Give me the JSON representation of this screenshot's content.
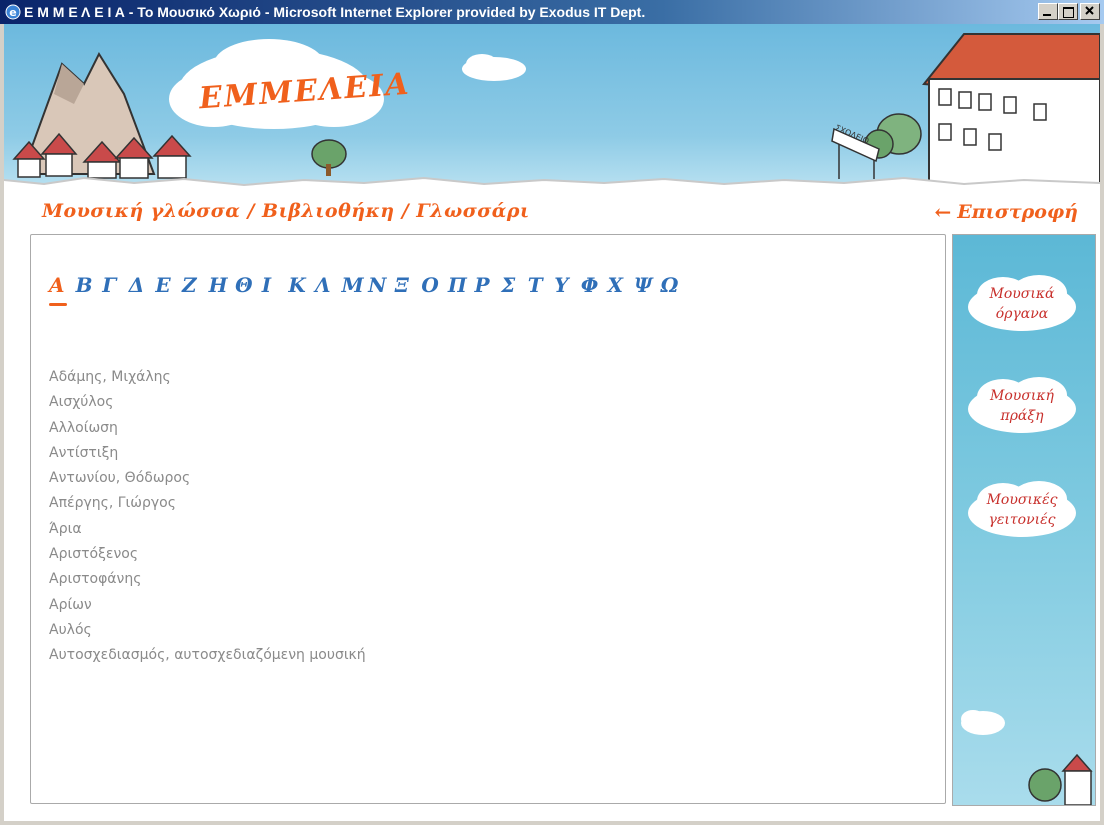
{
  "window": {
    "title": "Ε Μ Μ Ε Λ Ε Ι Α - Το Μουσικό Χωριό - Microsoft Internet Explorer provided by Exodus IT Dept."
  },
  "header": {
    "logo_text": "EMMEΛEIA",
    "school_sign": "ΣΧΟΛΕΙΟ"
  },
  "breadcrumb": "Μουσική γλώσσα / Βιβλιοθήκη / Γλωσσάρι",
  "back_link": "Επιστροφή",
  "alphabet": [
    "Α",
    "Β",
    "Γ",
    "Δ",
    "Ε",
    "Ζ",
    "Η",
    "Θ",
    "Ι",
    "Κ",
    "Λ",
    "Μ",
    "Ν",
    "Ξ",
    "Ο",
    "Π",
    "Ρ",
    "Σ",
    "Τ",
    "Υ",
    "Φ",
    "Χ",
    "Ψ",
    "Ω"
  ],
  "active_letter": "Α",
  "terms": [
    "Αδάμης, Μιχάλης",
    "Αισχύλος",
    "Αλλοίωση",
    "Αντίστιξη",
    "Αντωνίου, Θόδωρος",
    "Απέργης, Γιώργος",
    "Άρια",
    "Αριστόξενος",
    "Αριστοφάνης",
    "Αρίων",
    "Αυλός",
    "Αυτοσχεδιασμός, αυτοσχεδιαζόμενη μουσική"
  ],
  "sidebar": {
    "links": [
      {
        "line1": "Μουσικά",
        "line2": "όργανα"
      },
      {
        "line1": "Μουσική",
        "line2": "πράξη"
      },
      {
        "line1": "Μουσικές",
        "line2": "γειτονιές"
      }
    ]
  },
  "colors": {
    "accent_orange": "#f0601c",
    "letter_blue": "#2f6fb8",
    "term_gray": "#8a8a8a",
    "cloud_text_red": "#c8302c"
  }
}
